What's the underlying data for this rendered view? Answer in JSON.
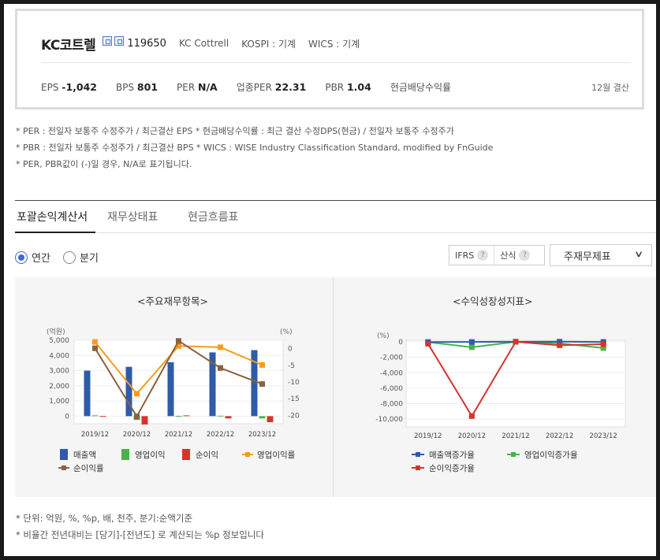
{
  "company": {
    "name": "KC코트렐",
    "code": "119650",
    "english_name": "KC Cottrell",
    "market": "KOSPI : 기계",
    "wics": "WICS : 기계",
    "badges": [
      "home-icon",
      "ir-icon"
    ]
  },
  "metrics": [
    {
      "label": "EPS",
      "value": "-1,042"
    },
    {
      "label": "BPS",
      "value": "801"
    },
    {
      "label": "PER",
      "value": "N/A"
    },
    {
      "label": "업종PER",
      "value": "22.31"
    },
    {
      "label": "PBR",
      "value": "1.04"
    },
    {
      "label": "현금배당수익률",
      "value": ""
    }
  ],
  "fiscal_label": "12월 결산",
  "notes": [
    "* PER : 전일자 보통주 수정주가 / 최근결산 EPS * 현금배당수익률 : 최근 결산 수정DPS(현금) / 전일자 보통주 수정주가",
    "* PBR : 전일자 보통주 수정주가 / 최근결산 BPS * WICS : WISE Industry Classification Standard, modified by FnGuide",
    "* PER, PBR값이 (-)일 경우, N/A로 표기됩니다."
  ],
  "tabs": [
    {
      "label": "포괄손익계산서",
      "active": true
    },
    {
      "label": "재무상태표",
      "active": false
    },
    {
      "label": "현금흐름표",
      "active": false
    }
  ],
  "period": {
    "annual_label": "연간",
    "quarter_label": "분기",
    "selected": "annual"
  },
  "options": {
    "ifrs_label": "IFRS",
    "calc_label": "산식",
    "help_icon": "?"
  },
  "statement_select": {
    "value": "주재무제표"
  },
  "colors": {
    "revenue": "#2e5ca8",
    "op_income": "#47b44a",
    "net_income": "#d4352b",
    "op_margin": "#f79b1d",
    "net_margin": "#8a6240"
  },
  "footer_notes": [
    "* 단위: 억원, %, %p, 배, 천주, 분기:순액기준",
    "* 비율간 전년대비는 [당기]-[전년도] 로 계산되는 %p 정보입니다"
  ],
  "chart_data": [
    {
      "type": "bar",
      "title": "<주요재무항목>",
      "categories": [
        "2019/12",
        "2020/12",
        "2021/12",
        "2022/12",
        "2023/12"
      ],
      "left_unit": "(억원)",
      "right_unit": "(%)",
      "ylim_left": [
        -500,
        5000
      ],
      "yticks_left": [
        "5,000",
        "4,000",
        "3,000",
        "2,000",
        "1,000",
        "0"
      ],
      "ylim_right": [
        -22.5,
        2.5
      ],
      "yticks_right": [
        "0",
        "-5",
        "-10",
        "-15",
        "-20"
      ],
      "bar_series": [
        {
          "name": "매출액",
          "values": [
            3000,
            3250,
            3550,
            4200,
            4350
          ]
        },
        {
          "name": "영업이익",
          "values": [
            50,
            -250,
            20,
            30,
            -150
          ]
        },
        {
          "name": "순이익",
          "values": [
            10,
            -550,
            50,
            -150,
            -400
          ]
        }
      ],
      "line_series": [
        {
          "name": "영업이익률",
          "values": [
            2.0,
            -13.5,
            0.8,
            0.4,
            -4.9
          ]
        },
        {
          "name": "순이익률",
          "values": [
            0.1,
            -20.3,
            2.3,
            -5.8,
            -10.6
          ]
        }
      ]
    },
    {
      "type": "line",
      "title": "<수익성장성지표>",
      "categories": [
        "2019/12",
        "2020/12",
        "2021/12",
        "2022/12",
        "2023/12"
      ],
      "unit": "(%)",
      "ylim": [
        -11000,
        200
      ],
      "yticks": [
        "0",
        "-2,000",
        "-4,000",
        "-6,000",
        "-8,000",
        "-10,000"
      ],
      "series": [
        {
          "name": "매출액증가율",
          "values": [
            -30,
            -20,
            15,
            18,
            -15
          ]
        },
        {
          "name": "영업이익증가율",
          "values": [
            -40,
            -700,
            0,
            -200,
            -800
          ]
        },
        {
          "name": "순이익증가율",
          "values": [
            -250,
            -9600,
            0,
            -450,
            -300
          ]
        }
      ]
    }
  ]
}
